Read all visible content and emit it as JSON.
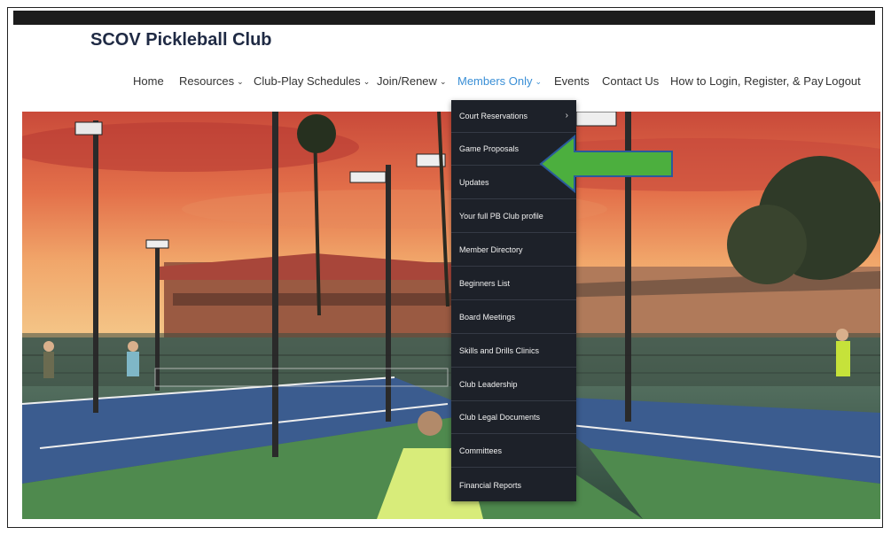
{
  "site": {
    "title": "SCOV Pickleball Club"
  },
  "nav": {
    "items": [
      {
        "label": "Home",
        "has_chevron": false
      },
      {
        "label": "Resources",
        "has_chevron": true
      },
      {
        "label": "Club-Play Schedules",
        "has_chevron": true
      },
      {
        "label": "Join/Renew",
        "has_chevron": true
      },
      {
        "label": "Members Only",
        "has_chevron": true,
        "active": true
      },
      {
        "label": "Events",
        "has_chevron": false
      },
      {
        "label": "Contact Us",
        "has_chevron": false
      },
      {
        "label": "How to Login, Register, & Pay",
        "has_chevron": false
      },
      {
        "label": "Logout",
        "has_chevron": false
      }
    ],
    "chevron_glyph": "⌄"
  },
  "dropdown": {
    "items": [
      {
        "label": "Court Reservations",
        "has_submenu": true
      },
      {
        "label": "Game Proposals"
      },
      {
        "label": "Updates"
      },
      {
        "label": "Your full PB Club profile"
      },
      {
        "label": "Member Directory"
      },
      {
        "label": "Beginners List"
      },
      {
        "label": "Board Meetings"
      },
      {
        "label": "Skills and Drills Clinics"
      },
      {
        "label": "Club Leadership"
      },
      {
        "label": "Club Legal Documents"
      },
      {
        "label": "Committees"
      },
      {
        "label": "Financial Reports"
      }
    ],
    "submenu_glyph": "›"
  },
  "colors": {
    "accent": "#3a8fd6",
    "dropdown_bg": "#1d2129",
    "annotation_arrow": "#4caf3e"
  }
}
